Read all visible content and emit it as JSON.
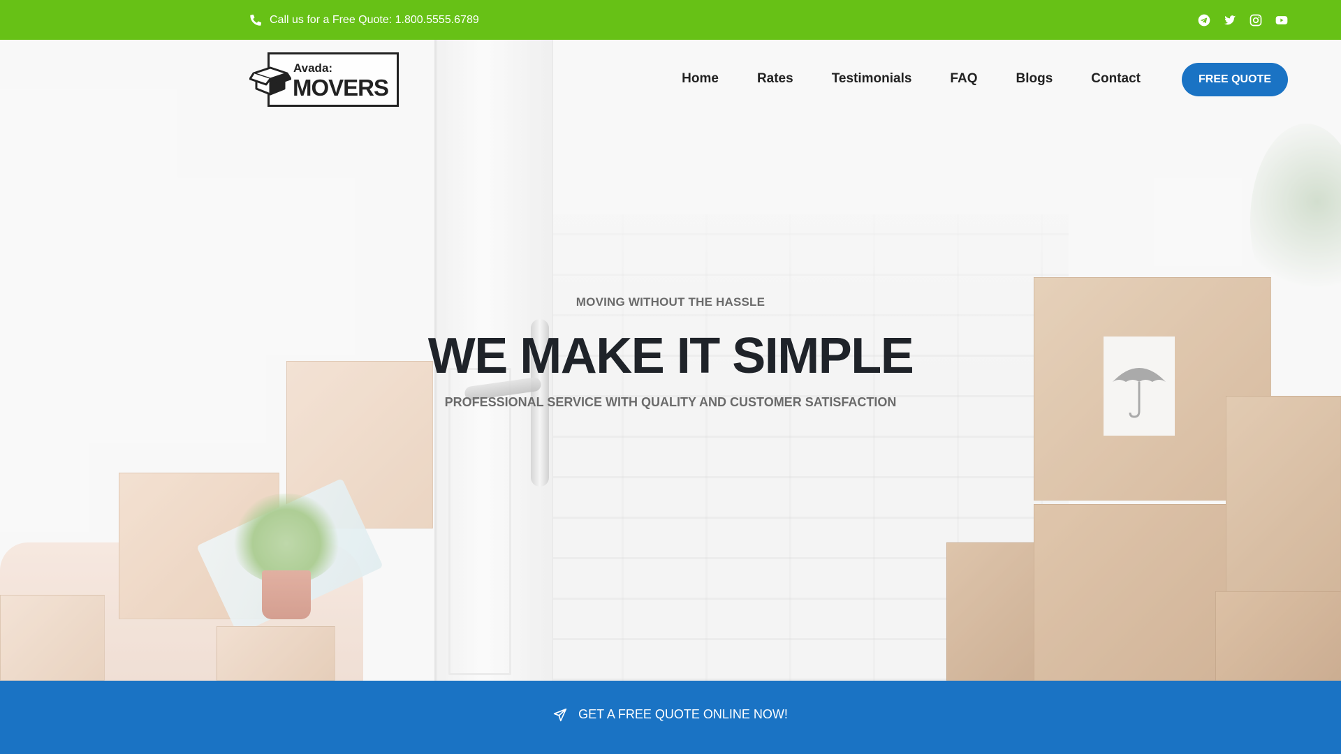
{
  "topbar": {
    "phone_text": "Call us for a Free Quote: 1.800.5555.6789",
    "phone_icon": "phone-icon",
    "social": [
      "telegram-icon",
      "twitter-icon",
      "instagram-icon",
      "youtube-icon"
    ]
  },
  "header": {
    "logo": {
      "sub": "Avada:",
      "name": "MOVERS"
    },
    "nav": [
      "Home",
      "Rates",
      "Testimonials",
      "FAQ",
      "Blogs",
      "Contact"
    ],
    "cta_label": "FREE QUOTE"
  },
  "hero": {
    "kicker": "MOVING WITHOUT THE HASSLE",
    "headline": "WE MAKE IT SIMPLE",
    "subline": "PROFESSIONAL SERVICE WITH QUALITY AND CUSTOMER SATISFACTION"
  },
  "band": {
    "quote_label": "GET A FREE QUOTE ONLINE NOW!",
    "icon": "paper-plane-icon"
  },
  "colors": {
    "topbar": "#67c116",
    "accent": "#1a73c4",
    "heading": "#1f2329",
    "muted": "#6a6a6a"
  }
}
